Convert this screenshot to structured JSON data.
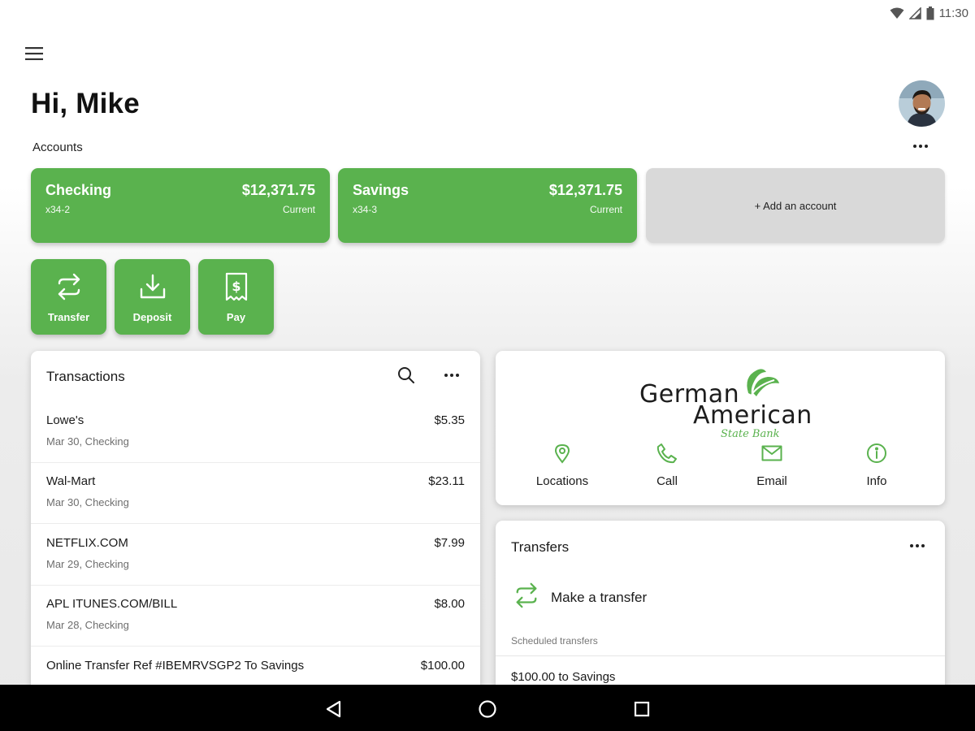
{
  "status_bar": {
    "time": "11:30"
  },
  "header": {
    "greeting": "Hi, Mike"
  },
  "accounts": {
    "label": "Accounts",
    "items": [
      {
        "name": "Checking",
        "number": "x34-2",
        "balance": "$12,371.75",
        "balance_type": "Current"
      },
      {
        "name": "Savings",
        "number": "x34-3",
        "balance": "$12,371.75",
        "balance_type": "Current"
      }
    ],
    "add_label": "+ Add an account"
  },
  "actions": [
    {
      "label": "Transfer",
      "icon": "transfer-icon"
    },
    {
      "label": "Deposit",
      "icon": "deposit-icon"
    },
    {
      "label": "Pay",
      "icon": "pay-bill-icon"
    }
  ],
  "transactions": {
    "title": "Transactions",
    "rows": [
      {
        "merchant": "Lowe's",
        "meta": "Mar 30, Checking",
        "amount": "$5.35"
      },
      {
        "merchant": "Wal-Mart",
        "meta": "Mar 30, Checking",
        "amount": "$23.11"
      },
      {
        "merchant": "NETFLIX.COM",
        "meta": "Mar 29, Checking",
        "amount": "$7.99"
      },
      {
        "merchant": "APL ITUNES.COM/BILL",
        "meta": "Mar 28, Checking",
        "amount": "$8.00"
      },
      {
        "merchant": "Online Transfer Ref #IBEMRVSGP2 To Savings",
        "meta": "",
        "amount": "$100.00"
      }
    ]
  },
  "bank": {
    "logo_line1": "German",
    "logo_line2": "American",
    "logo_line3": "State Bank",
    "contacts": [
      {
        "label": "Locations",
        "icon": "location-pin-icon"
      },
      {
        "label": "Call",
        "icon": "phone-icon"
      },
      {
        "label": "Email",
        "icon": "email-icon"
      },
      {
        "label": "Info",
        "icon": "info-icon"
      }
    ]
  },
  "transfers": {
    "title": "Transfers",
    "make_label": "Make a transfer",
    "scheduled_label": "Scheduled transfers",
    "scheduled_items": [
      "$100.00 to Savings"
    ]
  },
  "colors": {
    "brand_green": "#5ab24e",
    "add_card": "#d9d9d9"
  }
}
